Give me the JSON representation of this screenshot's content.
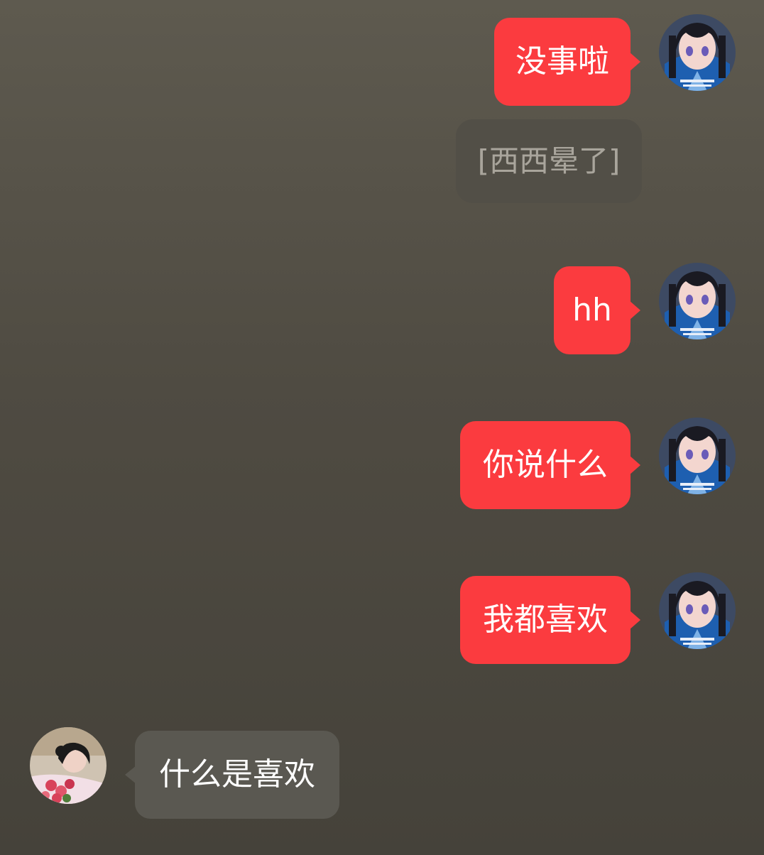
{
  "messages": [
    {
      "sender": "self",
      "type": "text",
      "text": "没事啦"
    },
    {
      "sender": "self",
      "type": "sticker",
      "text": "[西西晕了]"
    },
    {
      "sender": "self",
      "type": "text",
      "text": "hh"
    },
    {
      "sender": "self",
      "type": "text",
      "text": "你说什么"
    },
    {
      "sender": "self",
      "type": "text",
      "text": "我都喜欢"
    },
    {
      "sender": "other",
      "type": "text",
      "text": "什么是喜欢"
    }
  ],
  "colors": {
    "outgoing_bubble": "#fb3b3f",
    "incoming_bubble": "#5a5851",
    "sticker_placeholder": "#524f47",
    "background_top": "#5e5a4f",
    "background_bottom": "#45423a"
  },
  "icons": {
    "self_avatar": "anime-girl-avatar",
    "other_avatar": "person-with-flowers-avatar"
  }
}
